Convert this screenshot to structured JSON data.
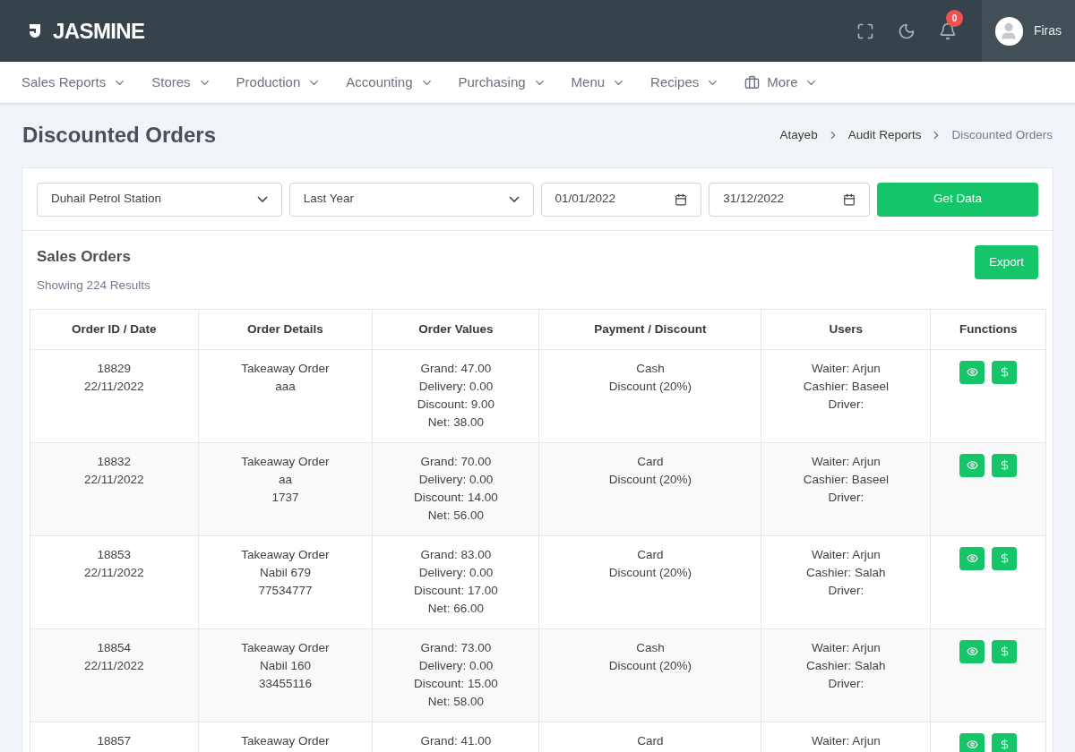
{
  "brand": {
    "name": "JASMINE"
  },
  "topbar": {
    "notification_count": "0",
    "user": "Firas"
  },
  "nav": [
    {
      "label": "Sales Reports",
      "icon": false
    },
    {
      "label": "Stores",
      "icon": false
    },
    {
      "label": "Production",
      "icon": false
    },
    {
      "label": "Accounting",
      "icon": false
    },
    {
      "label": "Purchasing",
      "icon": false
    },
    {
      "label": "Menu",
      "icon": false
    },
    {
      "label": "Recipes",
      "icon": false
    },
    {
      "label": "More",
      "icon": true
    }
  ],
  "page_title": "Discounted Orders",
  "breadcrumb": [
    "Atayeb",
    "Audit Reports",
    "Discounted Orders"
  ],
  "filters": {
    "store": "Duhail Petrol Station",
    "period": "Last Year",
    "from": "01/01/2022",
    "to": "31/12/2022",
    "button": "Get Data"
  },
  "section": {
    "title": "Sales Orders",
    "subtitle": "Showing 224 Results",
    "export": "Export"
  },
  "table": {
    "columns": [
      "Order ID / Date",
      "Order Details",
      "Order Values",
      "Payment / Discount",
      "Users",
      "Functions"
    ],
    "rows": [
      {
        "cells": [
          [
            "18829",
            "22/11/2022"
          ],
          [
            "Takeaway Order",
            "aaa"
          ],
          [
            "Grand: 47.00",
            "Delivery: 0.00",
            "Discount: 9.00",
            "Net: 38.00"
          ],
          [
            "Cash",
            "Discount (20%)"
          ],
          [
            "Waiter: Arjun",
            "Cashier: Baseel",
            "Driver:"
          ]
        ]
      },
      {
        "cells": [
          [
            "18832",
            "22/11/2022"
          ],
          [
            "Takeaway Order",
            "aa",
            "1737"
          ],
          [
            "Grand: 70.00",
            "Delivery: 0.00",
            "Discount: 14.00",
            "Net: 56.00"
          ],
          [
            "Card",
            "Discount (20%)"
          ],
          [
            "Waiter: Arjun",
            "Cashier: Baseel",
            "Driver:"
          ]
        ]
      },
      {
        "cells": [
          [
            "18853",
            "22/11/2022"
          ],
          [
            "Takeaway Order",
            "Nabil 679",
            "77534777"
          ],
          [
            "Grand: 83.00",
            "Delivery: 0.00",
            "Discount: 17.00",
            "Net: 66.00"
          ],
          [
            "Card",
            "Discount (20%)"
          ],
          [
            "Waiter: Arjun",
            "Cashier: Salah",
            "Driver:"
          ]
        ]
      },
      {
        "cells": [
          [
            "18854",
            "22/11/2022"
          ],
          [
            "Takeaway Order",
            "Nabil 160",
            "33455116"
          ],
          [
            "Grand: 73.00",
            "Delivery: 0.00",
            "Discount: 15.00",
            "Net: 58.00"
          ],
          [
            "Cash",
            "Discount (20%)"
          ],
          [
            "Waiter: Arjun",
            "Cashier: Salah",
            "Driver:"
          ]
        ]
      },
      {
        "cells": [
          [
            "18857"
          ],
          [
            "Takeaway Order"
          ],
          [
            "Grand: 41.00"
          ],
          [
            "Card"
          ],
          [
            "Waiter: Arjun"
          ]
        ]
      }
    ]
  }
}
